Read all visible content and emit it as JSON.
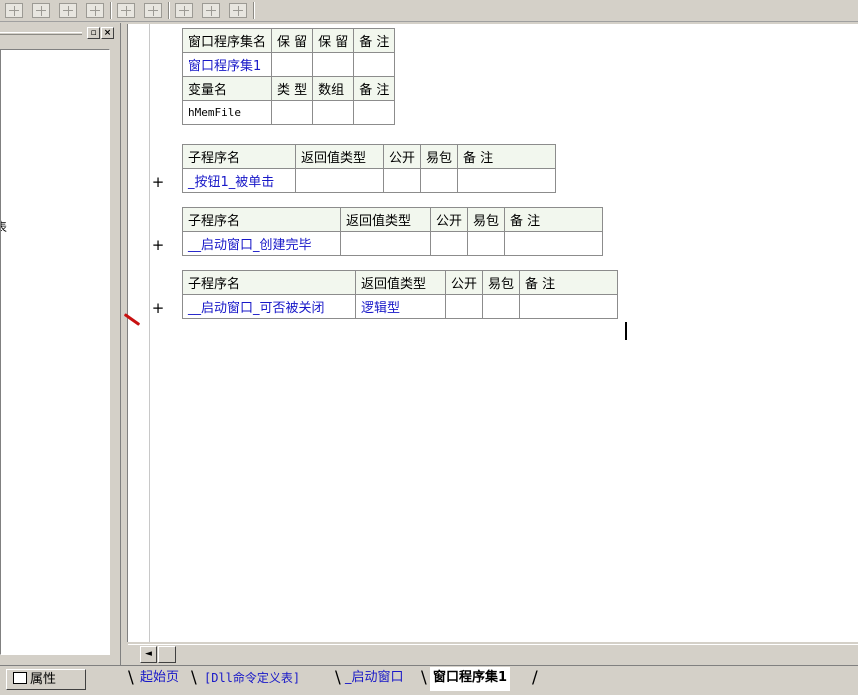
{
  "toolbar": {
    "icons": [
      "align-left-icon",
      "align-center-icon",
      "align-right-icon",
      "align-top-icon",
      "same-width-icon",
      "same-height-icon",
      "h-space-icon",
      "v-space-icon",
      "center-icon"
    ]
  },
  "left_panel": {
    "fragment_text": "表",
    "min_button": "▫",
    "close_button": "×"
  },
  "class_table": {
    "headers": [
      "窗口程序集名",
      "保 留",
      "保 留",
      "备 注"
    ],
    "row": [
      "窗口程序集1",
      "",
      "",
      ""
    ],
    "var_headers": [
      "变量名",
      "类 型",
      "数组",
      "备 注"
    ],
    "var_row": [
      "hMemFile",
      "",
      "",
      ""
    ]
  },
  "subs": [
    {
      "headers": [
        "子程序名",
        "返回值类型",
        "公开",
        "易包",
        "备 注"
      ],
      "name": "_按钮1_被单击",
      "return_type": "",
      "plus": "+"
    },
    {
      "headers": [
        "子程序名",
        "返回值类型",
        "公开",
        "易包",
        "备 注"
      ],
      "name": "__启动窗口_创建完毕",
      "return_type": "",
      "plus": "+"
    },
    {
      "headers": [
        "子程序名",
        "返回值类型",
        "公开",
        "易包",
        "备 注"
      ],
      "name": "__启动窗口_可否被关闭",
      "return_type": "逻辑型",
      "plus": "+"
    }
  ],
  "bottom": {
    "attr_label": "属性",
    "tabs": [
      "起始页",
      "[Dll命令定义表]",
      "_启动窗口",
      "窗口程序集1"
    ],
    "scroll_left": "◄"
  },
  "colors": {
    "link_blue": "#1818c8",
    "header_bg": "#f2f7ee",
    "marker_red": "#c81010"
  }
}
